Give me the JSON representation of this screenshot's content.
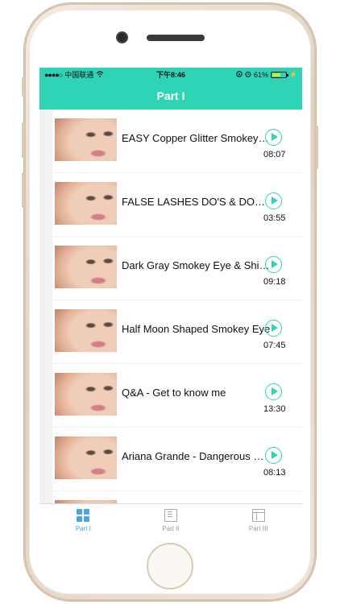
{
  "status_bar": {
    "carrier": "中国联通",
    "time": "下午8:46",
    "battery_percent_label": "61%",
    "battery_level": 0.61,
    "signal_icon": "signal-dots-icon",
    "wifi_icon": "wifi-icon",
    "alarm_icon": "alarm-icon",
    "lock_icon": "rotation-lock-icon"
  },
  "nav": {
    "title": "Part I"
  },
  "colors": {
    "accent": "#2fd3b5",
    "tab_active": "#3aa3e0",
    "tab_inactive": "#9a9a9a"
  },
  "videos": [
    {
      "title": "EASY Copper Glitter Smokey Eye",
      "duration": "08:07"
    },
    {
      "title": "FALSE LASHES DO'S & DON'TS",
      "duration": "03:55"
    },
    {
      "title": "Dark Gray Smokey Eye & Shimmer",
      "duration": "09:18"
    },
    {
      "title": "Half Moon Shaped Smokey Eye",
      "duration": "07:45"
    },
    {
      "title": "Q&A - Get to know me",
      "duration": "13:30"
    },
    {
      "title": "Ariana Grande - Dangerous Woman",
      "duration": "08:13"
    }
  ],
  "tabs": [
    {
      "label": "Part I",
      "icon": "grid-icon",
      "active": true
    },
    {
      "label": "Part II",
      "icon": "book-icon",
      "active": false
    },
    {
      "label": "Part III",
      "icon": "window-icon",
      "active": false
    }
  ]
}
